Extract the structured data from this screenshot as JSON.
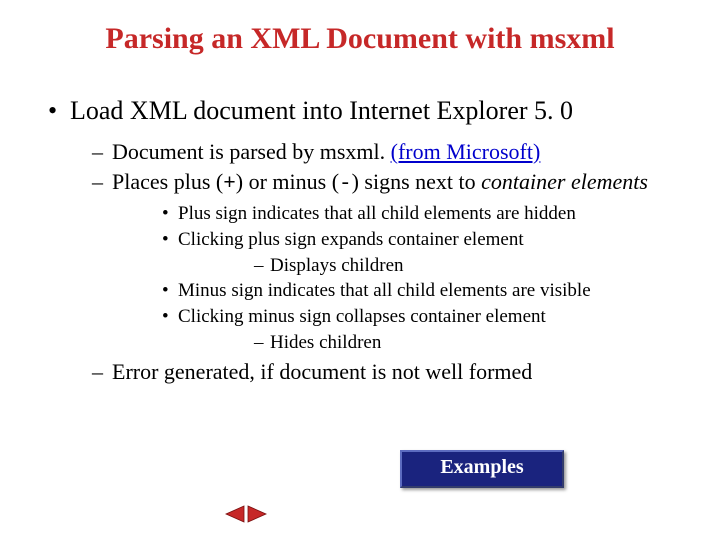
{
  "title": "Parsing an XML Document with msxml",
  "bullet1": "Load XML document into Internet Explorer 5. 0",
  "sub1_a_pre": "Document is parsed by msxml. ",
  "sub1_a_link": "(from Microsoft)",
  "sub1_b_pre": "Places plus (",
  "sub1_b_plus": "+",
  "sub1_b_mid": ") or minus (",
  "sub1_b_minus": "-",
  "sub1_b_post": ") signs next to ",
  "sub1_b_italic": "container elements",
  "sub2_a": "Plus sign indicates that all child elements are hidden",
  "sub2_b": "Clicking plus sign expands container element",
  "sub3_b1": "Displays children",
  "sub2_c": "Minus sign indicates that all child elements are visible",
  "sub2_d": "Clicking minus sign collapses container element",
  "sub3_d1": "Hides children",
  "sub1_c": "Error generated, if document is not well formed",
  "examples_label": "Examples",
  "colors": {
    "title": "#c62828",
    "link": "#0000cc",
    "nav_arrow": "#c62828",
    "button_bg": "#1a237e"
  }
}
